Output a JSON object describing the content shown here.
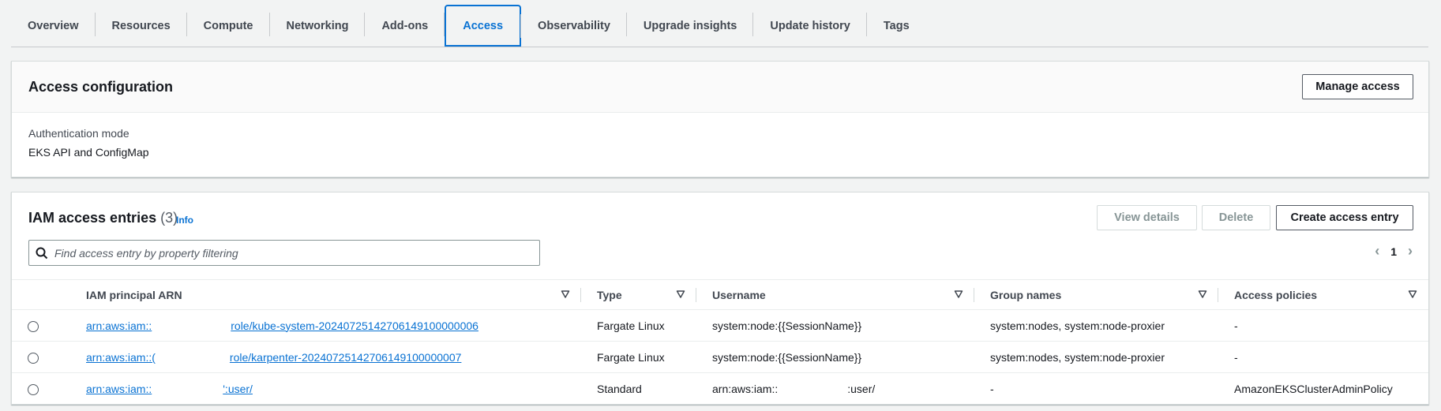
{
  "tabs": [
    {
      "label": "Overview",
      "active": false
    },
    {
      "label": "Resources",
      "active": false
    },
    {
      "label": "Compute",
      "active": false
    },
    {
      "label": "Networking",
      "active": false
    },
    {
      "label": "Add-ons",
      "active": false
    },
    {
      "label": "Access",
      "active": true
    },
    {
      "label": "Observability",
      "active": false
    },
    {
      "label": "Upgrade insights",
      "active": false
    },
    {
      "label": "Update history",
      "active": false
    },
    {
      "label": "Tags",
      "active": false
    }
  ],
  "access_config": {
    "title": "Access configuration",
    "manage_button": "Manage access",
    "auth_mode_label": "Authentication mode",
    "auth_mode_value": "EKS API and ConfigMap"
  },
  "entries": {
    "title": "IAM access entries",
    "count": "(3)",
    "info": "Info",
    "view_details": "View details",
    "delete": "Delete",
    "create": "Create access entry",
    "search_placeholder": "Find access entry by property filtering",
    "page": "1",
    "columns": [
      "IAM principal ARN",
      "Type",
      "Username",
      "Group names",
      "Access policies"
    ],
    "rows": [
      {
        "arn_prefix": "arn:aws:iam::",
        "arn_suffix": "role/kube-system-20240725142706149100000006",
        "type": "Fargate Linux",
        "username_prefix": "system:node:{{SessionName}}",
        "username_suffix": "",
        "groups": "system:nodes, system:node-proxier",
        "policies": "-"
      },
      {
        "arn_prefix": "arn:aws:iam::(",
        "arn_suffix": "role/karpenter-20240725142706149100000007",
        "type": "Fargate Linux",
        "username_prefix": "system:node:{{SessionName}}",
        "username_suffix": "",
        "groups": "system:nodes, system:node-proxier",
        "policies": "-"
      },
      {
        "arn_prefix": "arn:aws:iam::",
        "arn_suffix": "':user/",
        "type": "Standard",
        "username_prefix": "arn:aws:iam::",
        "username_suffix": ":user/",
        "groups": "-",
        "policies": "AmazonEKSClusterAdminPolicy"
      }
    ]
  },
  "colors": {
    "link": "#0972d3",
    "page_bg": "#f2f3f3",
    "text": "#16191f"
  }
}
